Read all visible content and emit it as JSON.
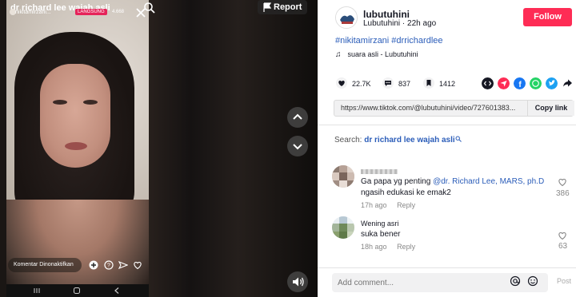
{
  "video": {
    "live_title": "dr richard lee wajah asli",
    "live_user": "nikitamirzani...",
    "live_badge": "LANGSUNG",
    "viewer_count": "4.668",
    "comment_bar": "Komentar Dinonaktifkan",
    "report_label": "Report"
  },
  "author": {
    "name": "lubutuhini",
    "subtitle": "Lubutuhini · 22h ago",
    "follow_label": "Follow"
  },
  "post": {
    "hashtags": "#nikitamirzani #drrichardlee",
    "music": "suara asli - Lubutuhini"
  },
  "stats": {
    "likes": "22.7K",
    "comments": "837",
    "saves": "1412"
  },
  "share_icons": [
    "embed-icon",
    "send-icon",
    "facebook-icon",
    "whatsapp-icon",
    "twitter-icon",
    "share-arrow-icon"
  ],
  "colors": {
    "accent": "#fe2c55",
    "link": "#2b5db9",
    "facebook": "#1877f2",
    "whatsapp": "#25d366",
    "twitter": "#1da1f2"
  },
  "url_bar": {
    "url": "https://www.tiktok.com/@lubutuhini/video/727601383...",
    "copy_label": "Copy link"
  },
  "search": {
    "prefix": "Search:",
    "term": "dr richard lee wajah asli"
  },
  "comments": [
    {
      "name": "",
      "text_before": "Ga papa yg penting ",
      "mention": "@dr. Richard Lee, MARS, ph.D",
      "text_after": "ngasih edukasi ke emak2",
      "time": "17h ago",
      "reply": "Reply",
      "likes": "386"
    },
    {
      "name": "Wening asri",
      "text_before": "suka bener",
      "time": "18h ago",
      "reply": "Reply",
      "likes": "63"
    }
  ],
  "comment_input": {
    "placeholder": "Add comment...",
    "post_label": "Post"
  }
}
